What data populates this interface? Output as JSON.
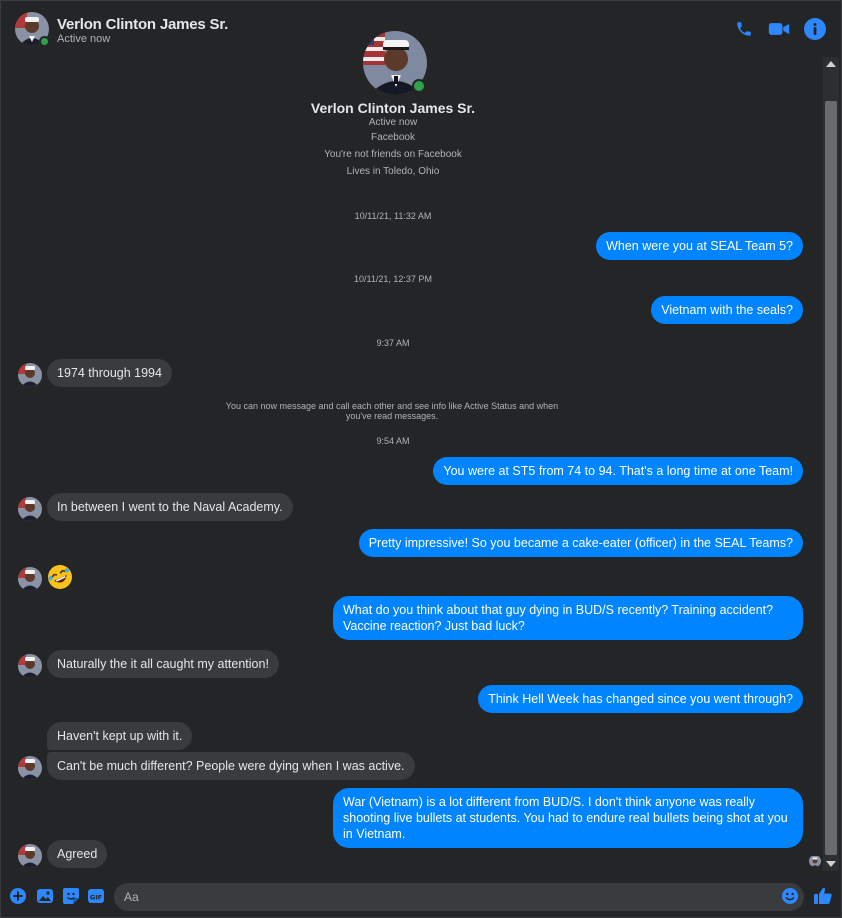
{
  "header": {
    "name": "Verlon Clinton James Sr.",
    "status": "Active now"
  },
  "profile": {
    "name": "Verlon Clinton James Sr.",
    "lines": [
      "Active now",
      "Facebook",
      "You're not friends on Facebook",
      "Lives in Toledo, Ohio"
    ]
  },
  "timestamps": [
    "10/11/21, 11:32 AM",
    "10/11/21, 12:37 PM",
    "9:37 AM",
    "9:54 AM"
  ],
  "notice": "You can now message and call each other and see info like Active Status and when you've read messages.",
  "messages": [
    {
      "dir": "out",
      "text": "When were you at SEAL Team 5?"
    },
    {
      "dir": "out",
      "text": "Vietnam with the seals?"
    },
    {
      "dir": "in",
      "text": "1974 through 1994"
    },
    {
      "dir": "out",
      "text": "You were at ST5 from 74 to 94. That's a long time at one Team!"
    },
    {
      "dir": "in",
      "text": "In between I went to the Naval Academy."
    },
    {
      "dir": "out",
      "text": "Pretty impressive! So you became a cake-eater (officer) in the SEAL Teams?"
    },
    {
      "dir": "in",
      "text": "🤣"
    },
    {
      "dir": "out",
      "text": "What do you think about that guy dying in BUD/S recently? Training accident? Vaccine reaction? Just bad luck?"
    },
    {
      "dir": "in",
      "text": "Naturally the it all caught my attention!"
    },
    {
      "dir": "out",
      "text": "Think Hell Week has changed since you went through?"
    },
    {
      "dir": "in",
      "text": "Haven't kept up with it."
    },
    {
      "dir": "in",
      "text": "Can't be much different? People were dying when I was active."
    },
    {
      "dir": "out",
      "text": "War (Vietnam) is a lot different from BUD/S. I don't think anyone was really shooting live bullets at students. You had to endure real bullets being shot at you in Vietnam."
    },
    {
      "dir": "in",
      "text": "Agreed"
    }
  ],
  "composer": {
    "placeholder": "Aa"
  },
  "colors": {
    "background": "#242526",
    "accent": "#0084ff",
    "incoming_bubble": "#3a3b3c",
    "online": "#31a24c"
  },
  "icons": [
    "phone-icon",
    "video-camera-icon",
    "info-icon",
    "plus-icon",
    "photo-icon",
    "sticker-icon",
    "gif-icon",
    "emoji-icon",
    "thumbs-up-icon"
  ]
}
